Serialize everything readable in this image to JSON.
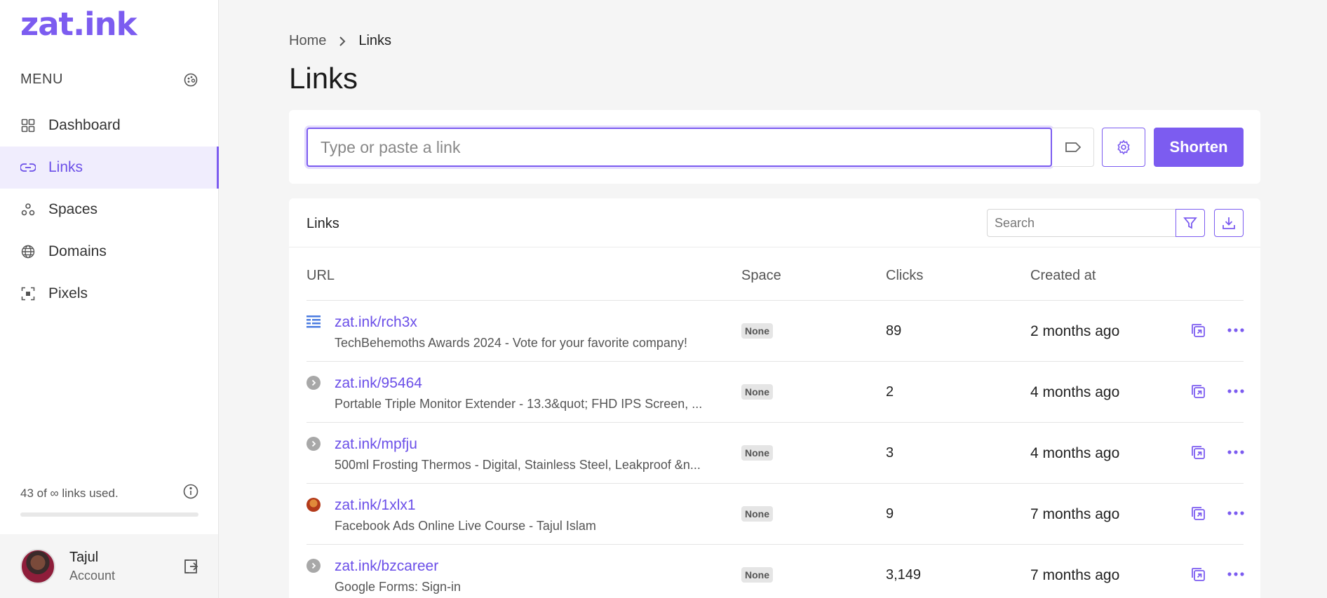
{
  "sidebar": {
    "logo": "zat.ink",
    "menu_title": "MENU",
    "items": [
      {
        "label": "Dashboard",
        "icon": "grid-icon"
      },
      {
        "label": "Links",
        "icon": "link-icon",
        "active": true
      },
      {
        "label": "Spaces",
        "icon": "spaces-icon"
      },
      {
        "label": "Domains",
        "icon": "globe-icon"
      },
      {
        "label": "Pixels",
        "icon": "pixel-icon"
      }
    ],
    "usage_text": "43 of ∞ links used.",
    "usage_fraction": 0.0,
    "account": {
      "name": "Tajul",
      "subtitle": "Account"
    }
  },
  "breadcrumb": {
    "home": "Home",
    "current": "Links"
  },
  "page_title": "Links",
  "shorten": {
    "placeholder": "Type or paste a link",
    "button_label": "Shorten"
  },
  "links_table": {
    "title": "Links",
    "search_placeholder": "Search",
    "columns": {
      "url": "URL",
      "space": "Space",
      "clicks": "Clicks",
      "created": "Created at"
    },
    "rows": [
      {
        "short": "zat.ink/rch3x",
        "title": "TechBehemoths Awards 2024 - Vote for your favorite company!",
        "space": "None",
        "clicks": "89",
        "created": "2 months ago",
        "favicon": "lines"
      },
      {
        "short": "zat.ink/95464",
        "title": "Portable Triple Monitor Extender - 13.3&quot; FHD IPS Screen, ...",
        "space": "None",
        "clicks": "2",
        "created": "4 months ago",
        "favicon": "default"
      },
      {
        "short": "zat.ink/mpfju",
        "title": "500ml Frosting Thermos - Digital, Stainless Steel, Leakproof &n...",
        "space": "None",
        "clicks": "3",
        "created": "4 months ago",
        "favicon": "default"
      },
      {
        "short": "zat.ink/1xlx1",
        "title": "Facebook Ads Online Live Course - Tajul Islam",
        "space": "None",
        "clicks": "9",
        "created": "7 months ago",
        "favicon": "photo"
      },
      {
        "short": "zat.ink/bzcareer",
        "title": "Google Forms: Sign-in",
        "space": "None",
        "clicks": "3,149",
        "created": "7 months ago",
        "favicon": "default"
      }
    ]
  },
  "colors": {
    "accent": "#7c5cf0",
    "accent_bg": "#f0edfd"
  }
}
